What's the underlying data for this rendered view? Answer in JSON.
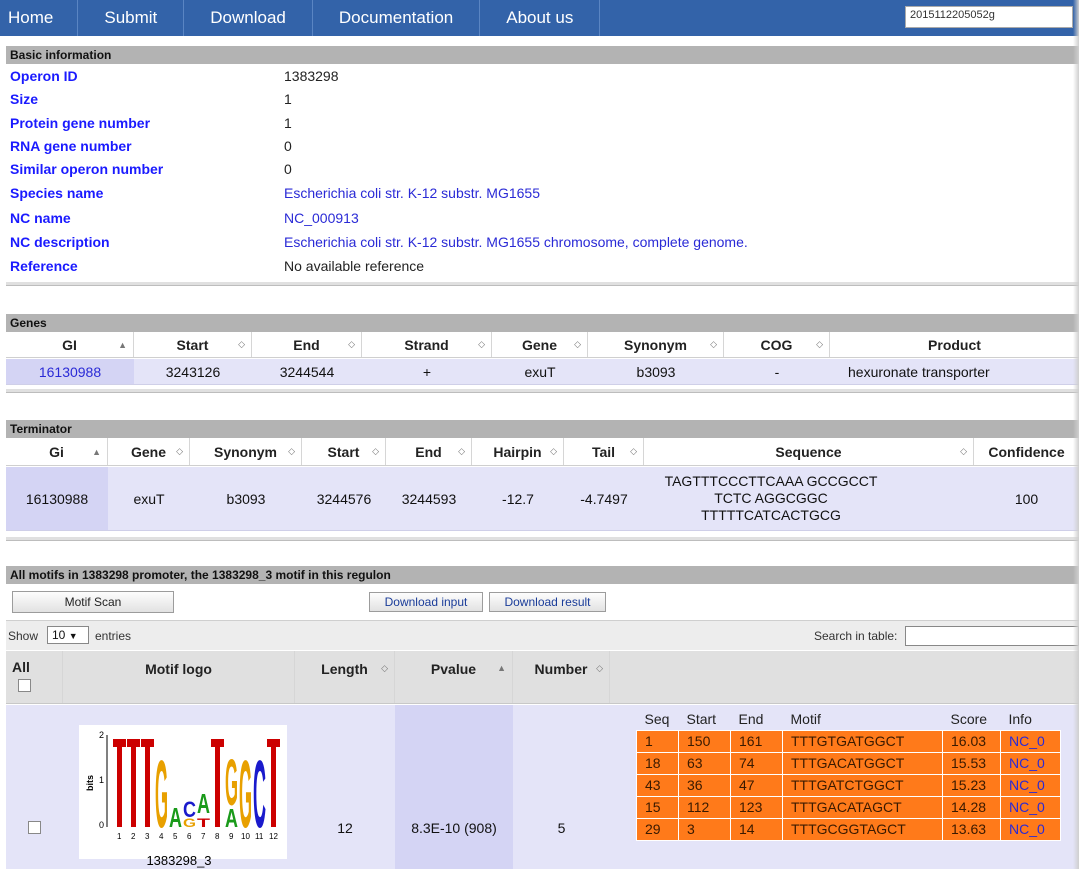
{
  "nav": {
    "items": [
      "Home",
      "Submit",
      "Download",
      "Documentation",
      "About us"
    ],
    "search_value": "2015112205052g"
  },
  "basic": {
    "title": "Basic information",
    "rows": [
      {
        "label": "Operon ID",
        "value": "1383298"
      },
      {
        "label": "Size",
        "value": "1"
      },
      {
        "label": "Protein gene number",
        "value": "1"
      },
      {
        "label": "RNA gene number",
        "value": "0"
      },
      {
        "label": "Similar operon number",
        "value": "0"
      },
      {
        "label": "Species name",
        "value": "Escherichia coli str. K-12 substr. MG1655"
      },
      {
        "label": "NC name",
        "value": "NC_000913"
      },
      {
        "label": "NC description",
        "value": "Escherichia coli str. K-12 substr. MG1655 chromosome, complete genome."
      },
      {
        "label": "Reference",
        "value": "No available reference"
      }
    ]
  },
  "genes": {
    "title": "Genes",
    "headers": [
      "GI",
      "Start",
      "End",
      "Strand",
      "Gene",
      "Synonym",
      "COG",
      "Product"
    ],
    "row": [
      "16130988",
      "3243126",
      "3244544",
      "+",
      "exuT",
      "b3093",
      "-",
      "hexuronate transporter"
    ]
  },
  "terminator": {
    "title": "Terminator",
    "headers": [
      "Gi",
      "Gene",
      "Synonym",
      "Start",
      "End",
      "Hairpin",
      "Tail",
      "Sequence",
      "Confidence"
    ],
    "row": [
      "16130988",
      "exuT",
      "b3093",
      "3244576",
      "3244593",
      "-12.7",
      "-4.7497",
      "",
      "100"
    ],
    "sequence_lines": [
      "TAGTTTCCCTTCAAA GCCGCCT",
      "TCTC AGGCGGC",
      "TTTTTCATCACTGCG"
    ]
  },
  "motifs": {
    "title": "All motifs in 1383298 promoter, the 1383298_3 motif in this regulon",
    "scan_button": "Motif Scan",
    "download_input": "Download input",
    "download_result": "Download result",
    "show_label": "Show",
    "show_value": "10",
    "entries_label": "entries",
    "search_label": "Search in table:",
    "headers": [
      "All",
      "Motif logo",
      "Length",
      "Pvalue",
      "Number"
    ],
    "row": {
      "logo_caption": "1383298_3",
      "length": "12",
      "pvalue": "8.3E-10 (908)",
      "number": "5"
    },
    "logo_axis": {
      "label": "bits",
      "ticks": [
        "2",
        "1",
        "0"
      ],
      "positions": [
        "1",
        "2",
        "3",
        "4",
        "5",
        "6",
        "7",
        "8",
        "9",
        "10",
        "11",
        "12"
      ]
    },
    "sub_headers": [
      "Seq",
      "Start",
      "End",
      "Motif",
      "Score",
      "Info"
    ],
    "sub_rows": [
      [
        "1",
        "150",
        "161",
        "TTTGTGATGGCT",
        "16.03",
        "NC_0"
      ],
      [
        "18",
        "63",
        "74",
        "TTTGACATGGCT",
        "15.53",
        "NC_0"
      ],
      [
        "43",
        "36",
        "47",
        "TTTGATCTGGCT",
        "15.23",
        "NC_0"
      ],
      [
        "15",
        "112",
        "123",
        "TTTGACATAGCT",
        "14.28",
        "NC_0"
      ],
      [
        "29",
        "3",
        "14",
        "TTTGCGGTAGCT",
        "13.63",
        "NC_0"
      ]
    ]
  },
  "colors": {
    "nav": "#3363a9",
    "header_bar": "#b3b3b3",
    "row": "#e4e4f8",
    "motif_cell": "#ff7a1a",
    "logo_T": "#cc0000",
    "logo_G": "#e8a000",
    "logo_A": "#1a9a1a",
    "logo_C": "#1a1acc"
  }
}
